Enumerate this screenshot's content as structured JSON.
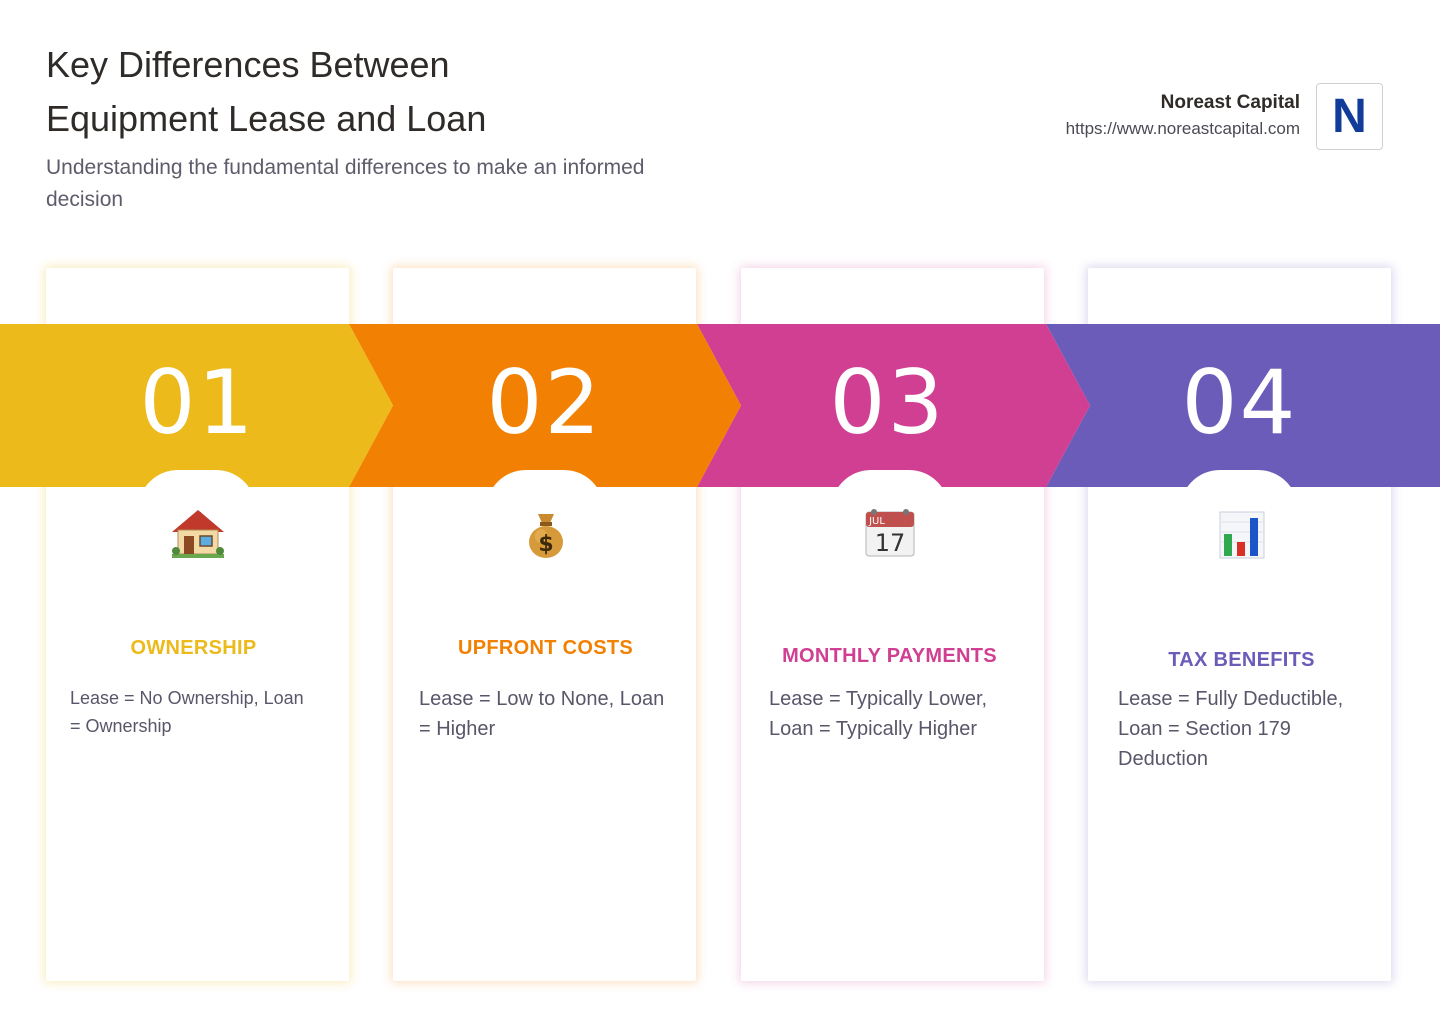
{
  "header": {
    "title_line1": "Key Differences Between",
    "title_line2": "Equipment Lease and Loan",
    "subtitle": "Understanding the fundamental differences to make an informed decision"
  },
  "brand": {
    "name": "Noreast Capital",
    "url": "https://www.noreastcapital.com",
    "logo_letter": "N"
  },
  "colors": {
    "yellow": "#ECBA1A",
    "orange": "#F28002",
    "magenta": "#D03F91",
    "purple": "#6C5CBA"
  },
  "steps": [
    {
      "number": "01",
      "icon": "house-icon",
      "heading": "OWNERSHIP",
      "body": "Lease = No Ownership, Loan = Ownership"
    },
    {
      "number": "02",
      "icon": "money-bag-icon",
      "heading": "UPFRONT COSTS",
      "body": "Lease = Low to None, Loan = Higher"
    },
    {
      "number": "03",
      "icon": "calendar-icon",
      "heading": "MONTHLY PAYMENTS",
      "body": "Lease = Typically Lower, Loan = Typically Higher"
    },
    {
      "number": "04",
      "icon": "bar-chart-icon",
      "heading": "TAX BENEFITS",
      "body": "Lease = Fully Deductible, Loan = Section 179 Deduction"
    }
  ],
  "calendar": {
    "month": "JUL",
    "day": "17"
  }
}
